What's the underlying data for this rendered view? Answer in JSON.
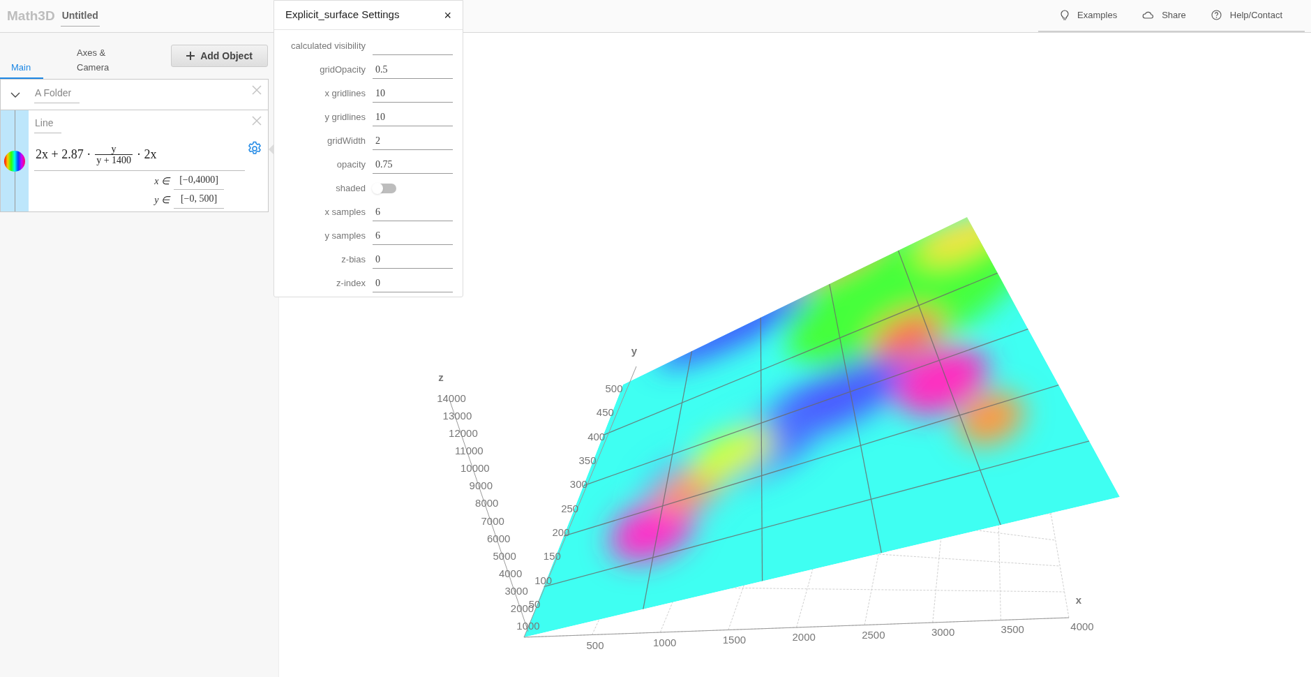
{
  "app": {
    "logo": "Math3D",
    "title": "Untitled"
  },
  "header_links": [
    {
      "label": "Examples"
    },
    {
      "label": "Share"
    },
    {
      "label": "Help/Contact"
    }
  ],
  "tabs": [
    {
      "label": "Main",
      "selected": true
    },
    {
      "label": "Axes & Camera",
      "selected": false
    }
  ],
  "add_button": "Add Object",
  "objects": [
    {
      "kind": "folder",
      "label": "A Folder",
      "expanded": true
    },
    {
      "kind": "surface",
      "label": "Line",
      "expression": {
        "lead": "2x + 2.87 ·",
        "numerator": "y",
        "denominator": "y + 1400",
        "tail": "· 2x"
      },
      "ranges": [
        {
          "variable": "x ∈",
          "interval": "[−0,4000]"
        },
        {
          "variable": "y ∈",
          "interval": "[−0, 500]"
        }
      ]
    }
  ],
  "settings": {
    "title": "Explicit_surface Settings",
    "close": "×",
    "fields": [
      {
        "kind": "text",
        "label": "calculated visibility"
      },
      {
        "kind": "text",
        "label": "gridOpacity",
        "value": "0.5"
      },
      {
        "kind": "text",
        "label": "x gridlines",
        "value": "10"
      },
      {
        "kind": "text",
        "label": "y gridlines",
        "value": "10"
      },
      {
        "kind": "text",
        "label": "gridWidth",
        "value": "2"
      },
      {
        "kind": "text",
        "label": "opacity",
        "value": "0.75"
      },
      {
        "kind": "toggle",
        "label": "shaded",
        "on": false
      },
      {
        "kind": "text",
        "label": "x samples",
        "value": "6"
      },
      {
        "kind": "text",
        "label": "y samples",
        "value": "6"
      },
      {
        "kind": "text",
        "label": "z-bias",
        "value": "0"
      },
      {
        "kind": "text",
        "label": "z-index",
        "value": "0"
      }
    ]
  },
  "scene": {
    "axes": [
      {
        "name": "x",
        "ticks": [
          "500",
          "1000",
          "1500",
          "2000",
          "2500",
          "3000",
          "3500",
          "4000"
        ]
      },
      {
        "name": "y",
        "ticks": [
          "50",
          "100",
          "150",
          "200",
          "250",
          "300",
          "350",
          "400",
          "450",
          "500"
        ]
      },
      {
        "name": "z",
        "ticks": [
          "1000",
          "2000",
          "3000",
          "4000",
          "5000",
          "6000",
          "7000",
          "8000",
          "9000",
          "10000",
          "11000",
          "12000",
          "13000",
          "14000"
        ]
      }
    ]
  }
}
